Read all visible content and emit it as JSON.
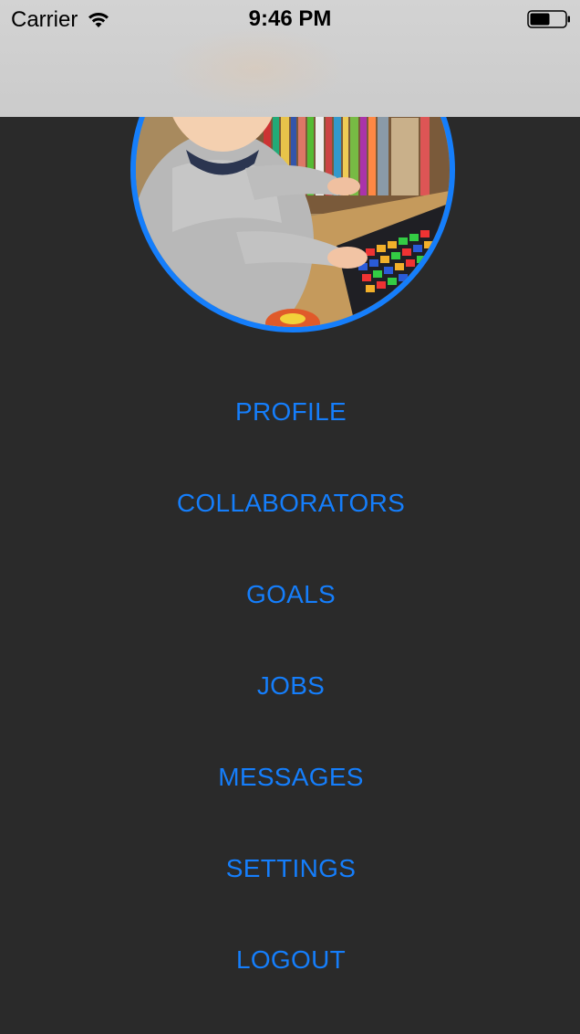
{
  "status_bar": {
    "carrier": "Carrier",
    "time": "9:46 PM",
    "wifi_icon": "wifi-icon",
    "battery_icon": "battery-icon"
  },
  "profile": {
    "avatar_icon": "avatar",
    "border_color": "#157efb"
  },
  "menu": {
    "items": [
      {
        "label": "PROFILE"
      },
      {
        "label": "COLLABORATORS"
      },
      {
        "label": "GOALS"
      },
      {
        "label": "JOBS"
      },
      {
        "label": "MESSAGES"
      },
      {
        "label": "SETTINGS"
      },
      {
        "label": "LOGOUT"
      }
    ]
  },
  "colors": {
    "background": "#2a2a2a",
    "accent": "#157efb"
  }
}
